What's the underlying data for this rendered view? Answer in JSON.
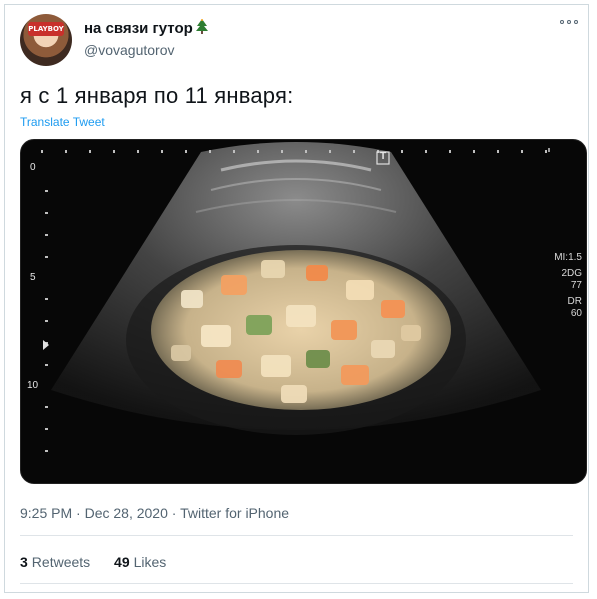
{
  "user": {
    "display_name": "на связи гутор",
    "handle": "@vovagutorov",
    "avatar_caption": "PLAYBOY"
  },
  "tweet": {
    "text": "я с 1 января по 11 января:",
    "translate_label": "Translate Tweet"
  },
  "media": {
    "depth_labels": [
      "0",
      "5",
      "10"
    ],
    "marker_label": "T",
    "right_labels": [
      "MI:1.5",
      "2DG",
      "77",
      "DR",
      "60"
    ]
  },
  "meta": {
    "time": "9:25 PM",
    "date": "Dec 28, 2020",
    "source": "Twitter for iPhone"
  },
  "stats": {
    "retweets_count": "3",
    "retweets_label": "Retweets",
    "likes_count": "49",
    "likes_label": "Likes"
  },
  "colors": {
    "accent": "#1d9bf0",
    "secondary_text": "#536471",
    "border": "#cfd9de"
  },
  "icons": [
    "christmas-tree-icon",
    "more-options-icon"
  ]
}
